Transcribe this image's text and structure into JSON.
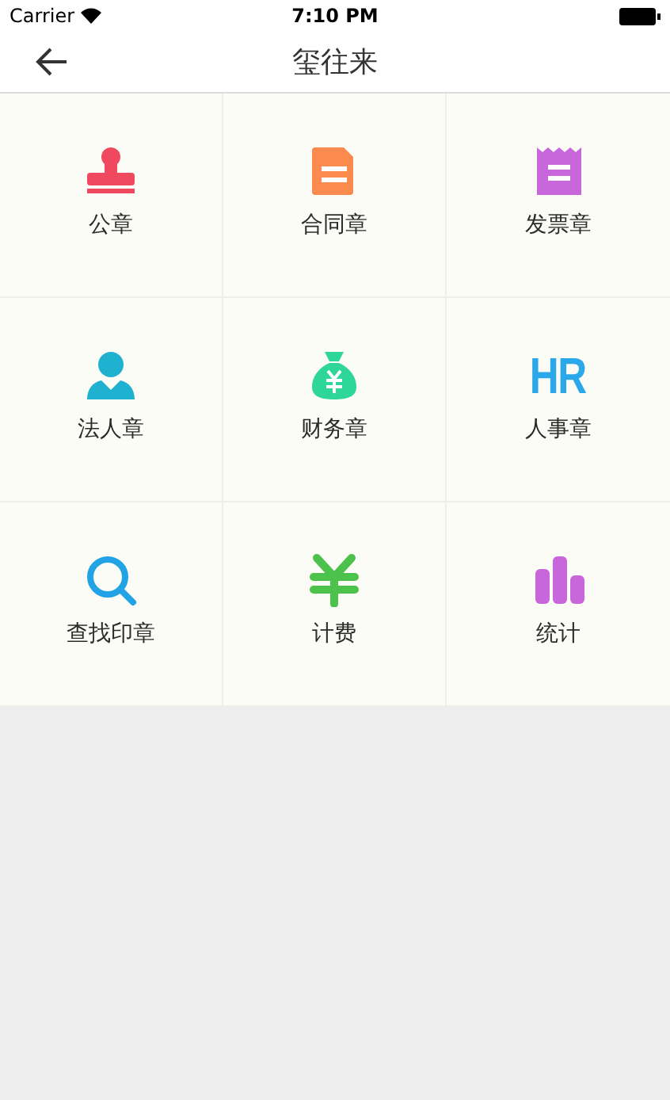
{
  "status_bar": {
    "carrier": "Carrier",
    "time": "7:10 PM"
  },
  "nav_bar": {
    "title": "玺往来"
  },
  "grid_rows": [
    {
      "tiles": [
        {
          "label": "公章",
          "color": "#f0485e"
        },
        {
          "label": "合同章",
          "color": "#fb8a4f"
        },
        {
          "label": "发票章",
          "color": "#c866dc"
        }
      ]
    },
    {
      "tiles": [
        {
          "label": "法人章",
          "color": "#1eb1d0"
        },
        {
          "label": "财务章",
          "color": "#2fd69a"
        },
        {
          "label": "人事章",
          "icon_text": "HR",
          "color": "#2aa8ea"
        }
      ]
    },
    {
      "tiles": [
        {
          "label": "查找印章",
          "color": "#21a3e6"
        },
        {
          "label": "计费",
          "color": "#4cc24c"
        },
        {
          "label": "统计",
          "color": "#c866dc"
        }
      ]
    }
  ]
}
